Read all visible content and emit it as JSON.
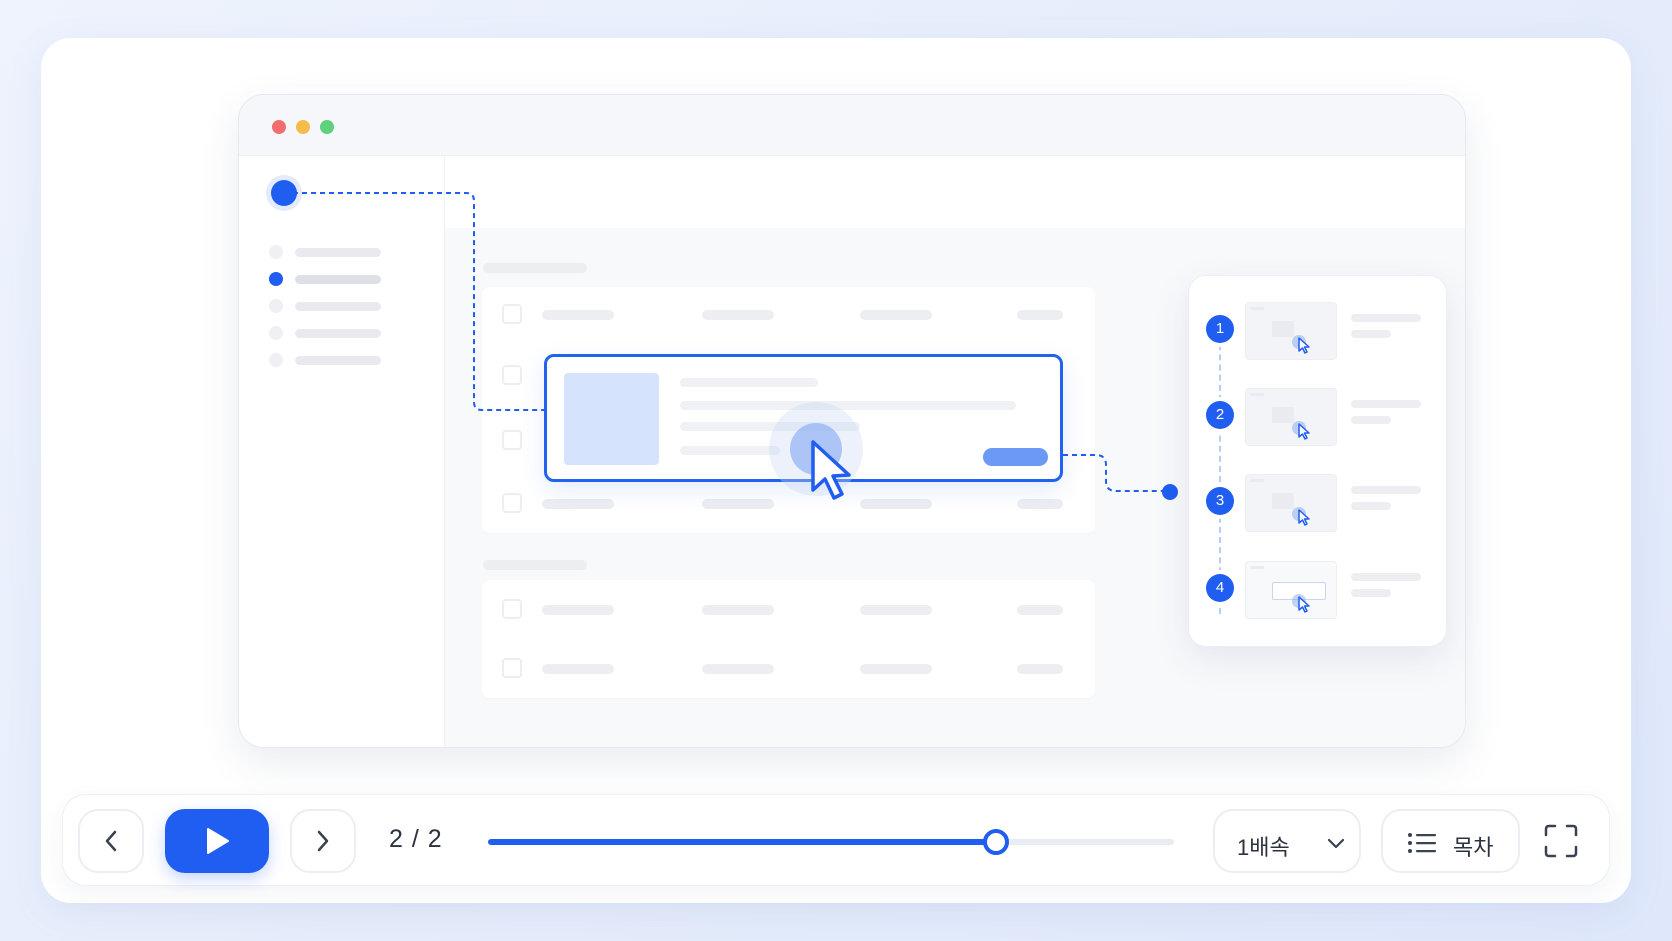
{
  "steps": [
    {
      "number": "1"
    },
    {
      "number": "2"
    },
    {
      "number": "3"
    },
    {
      "number": "4"
    }
  ],
  "player": {
    "page_indicator": "2 / 2",
    "progress": 0.74,
    "speed_label": "1배속",
    "toc_label": "목차"
  },
  "icons": {
    "prev": "chevron-left-icon",
    "play": "play-icon",
    "next": "chevron-right-icon",
    "speed_dropdown": "chevron-down-icon",
    "toc": "list-icon",
    "fullscreen": "fullscreen-icon",
    "cursor": "mouse-pointer-icon"
  },
  "colors": {
    "accent": "#1f5ef0",
    "window_red": "#f26d6d",
    "window_yellow": "#f6bc4b",
    "window_green": "#5fd17c"
  }
}
